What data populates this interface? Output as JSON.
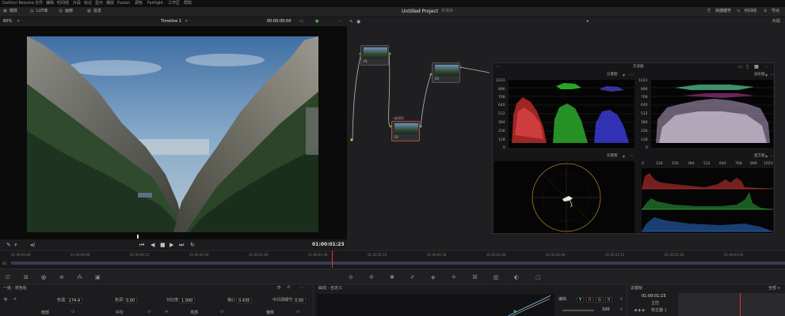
{
  "app": {
    "name": "DaVinci Resolve",
    "project_title": "Untitled Project",
    "project_status": "未保存"
  },
  "menu": {
    "items": [
      "文件",
      "编辑",
      "时间线",
      "片段",
      "标记",
      "显示",
      "播放",
      "Fusion",
      "调色",
      "Fairlight",
      "工作区",
      "帮助"
    ]
  },
  "toolbar": {
    "left_items": [
      "媒体",
      "LUT库",
      "画廊",
      "信息"
    ],
    "right_items": [
      "快捷键符",
      "时间线",
      "节点"
    ],
    "node_tab": "片段"
  },
  "viewer": {
    "zoom": "60%",
    "timeline_name": "Timeline 1",
    "timecode_top": "00:00:00:00",
    "timecode_bottom": "01:00:01:23"
  },
  "nodes": {
    "n1": "01",
    "n2": "02",
    "n3": "03",
    "n2_caption": "一级调色"
  },
  "scopes": {
    "title": "示波器",
    "parade_label": "分量图",
    "wave_label": "波形图",
    "vector_label": "矢量图",
    "histogram_label": "直方图",
    "y_ticks": [
      "1023",
      "896",
      "768",
      "640",
      "512",
      "384",
      "256",
      "128",
      "0"
    ],
    "hist_ticks": [
      "0",
      "128",
      "256",
      "384",
      "512",
      "640",
      "768",
      "896",
      "1023"
    ]
  },
  "timeline": {
    "track": "V1",
    "ticks": [
      "01:00:00:00",
      "01:00:00:06",
      "01:00:00:12",
      "01:00:00:18",
      "01:00:01:00",
      "01:00:01:06",
      "01:00:01:12",
      "01:00:01:18",
      "01:00:02:00",
      "01:00:02:06",
      "01:00:02:12",
      "01:00:02:18",
      "01:00:03:00",
      "01:00:03:06",
      "01:00:03:12",
      "01:00:03:18",
      "01:00:04:00",
      "01:00:04:06",
      "01:00:04:12"
    ]
  },
  "primaries": {
    "header": "一级 - 校色轮",
    "params": [
      {
        "label": "色温",
        "value": "-174.4"
      },
      {
        "label": "色调",
        "value": "0.00"
      },
      {
        "label": "对比度",
        "value": "1.000"
      },
      {
        "label": "轴心",
        "value": "0.435"
      },
      {
        "label": "中间调细节",
        "value": "0.00"
      }
    ],
    "wheels": [
      "暗部",
      "中灰",
      "亮部",
      "偏移"
    ]
  },
  "curves": {
    "header": "曲线 - 自定义",
    "edit_label": "编辑",
    "value": "100",
    "channels": [
      "Y",
      "R",
      "G",
      "B"
    ]
  },
  "keyframes": {
    "header": "关键帧",
    "mode": "全部",
    "timecode": "01:00:01:23",
    "row1": "主控",
    "row2": "校正器 1"
  },
  "colors": {
    "accent_red": "#d33333",
    "scope_bg": "#050505",
    "timeline_clip": "#3a3a5a"
  }
}
